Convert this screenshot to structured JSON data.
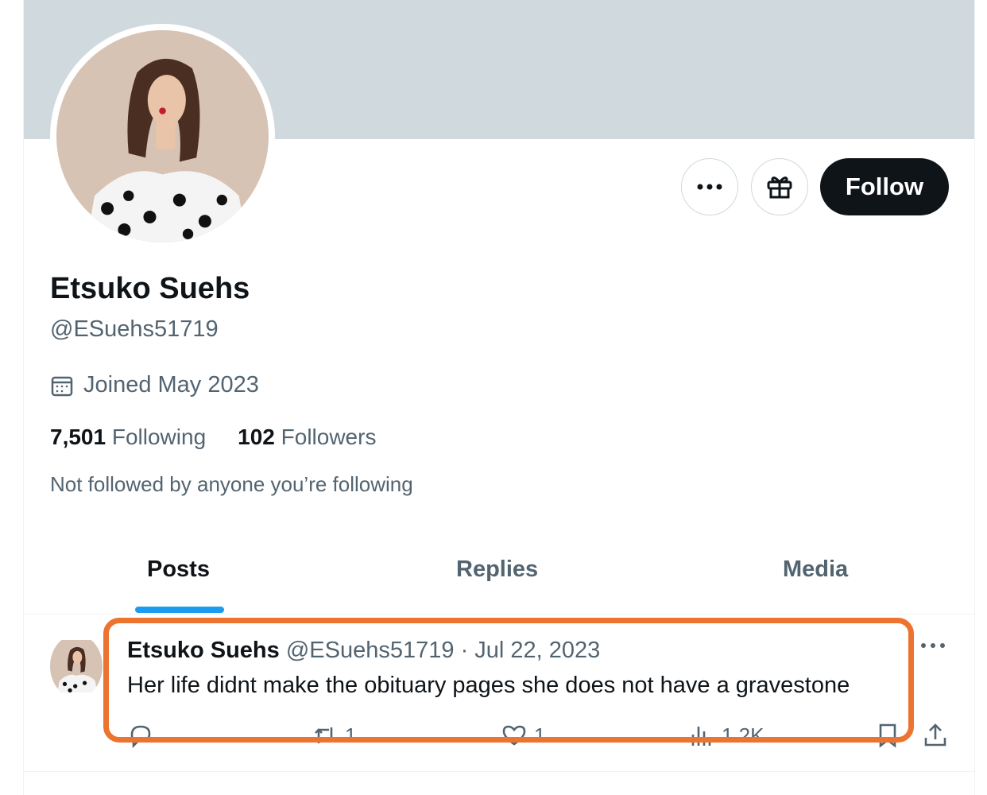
{
  "profile": {
    "name": "Etsuko Suehs",
    "handle": "@ESuehs51719",
    "joined": "Joined May 2023",
    "following_count": "7,501",
    "following_label": "Following",
    "followers_count": "102",
    "followers_label": "Followers",
    "not_followed_text": "Not followed by anyone you’re following"
  },
  "actions": {
    "follow_label": "Follow"
  },
  "tabs": [
    {
      "label": "Posts",
      "active": true
    },
    {
      "label": "Replies",
      "active": false
    },
    {
      "label": "Media",
      "active": false
    }
  ],
  "post": {
    "author_name": "Etsuko Suehs",
    "author_handle": "@ESuehs51719",
    "separator": "·",
    "date": "Jul 22, 2023",
    "text": "Her life didnt make the obituary pages she does not have a gravestone",
    "reposts": "1",
    "likes": "1",
    "views": "1.2K"
  },
  "colors": {
    "banner": "#cfd9de",
    "accent": "#1d9bf0",
    "highlight": "#ed7430",
    "follow_button": "#0f1419"
  },
  "icons": [
    "more-icon",
    "gift-icon",
    "calendar-icon",
    "reply-icon",
    "repost-icon",
    "like-icon",
    "views-icon",
    "bookmark-icon",
    "share-icon"
  ]
}
